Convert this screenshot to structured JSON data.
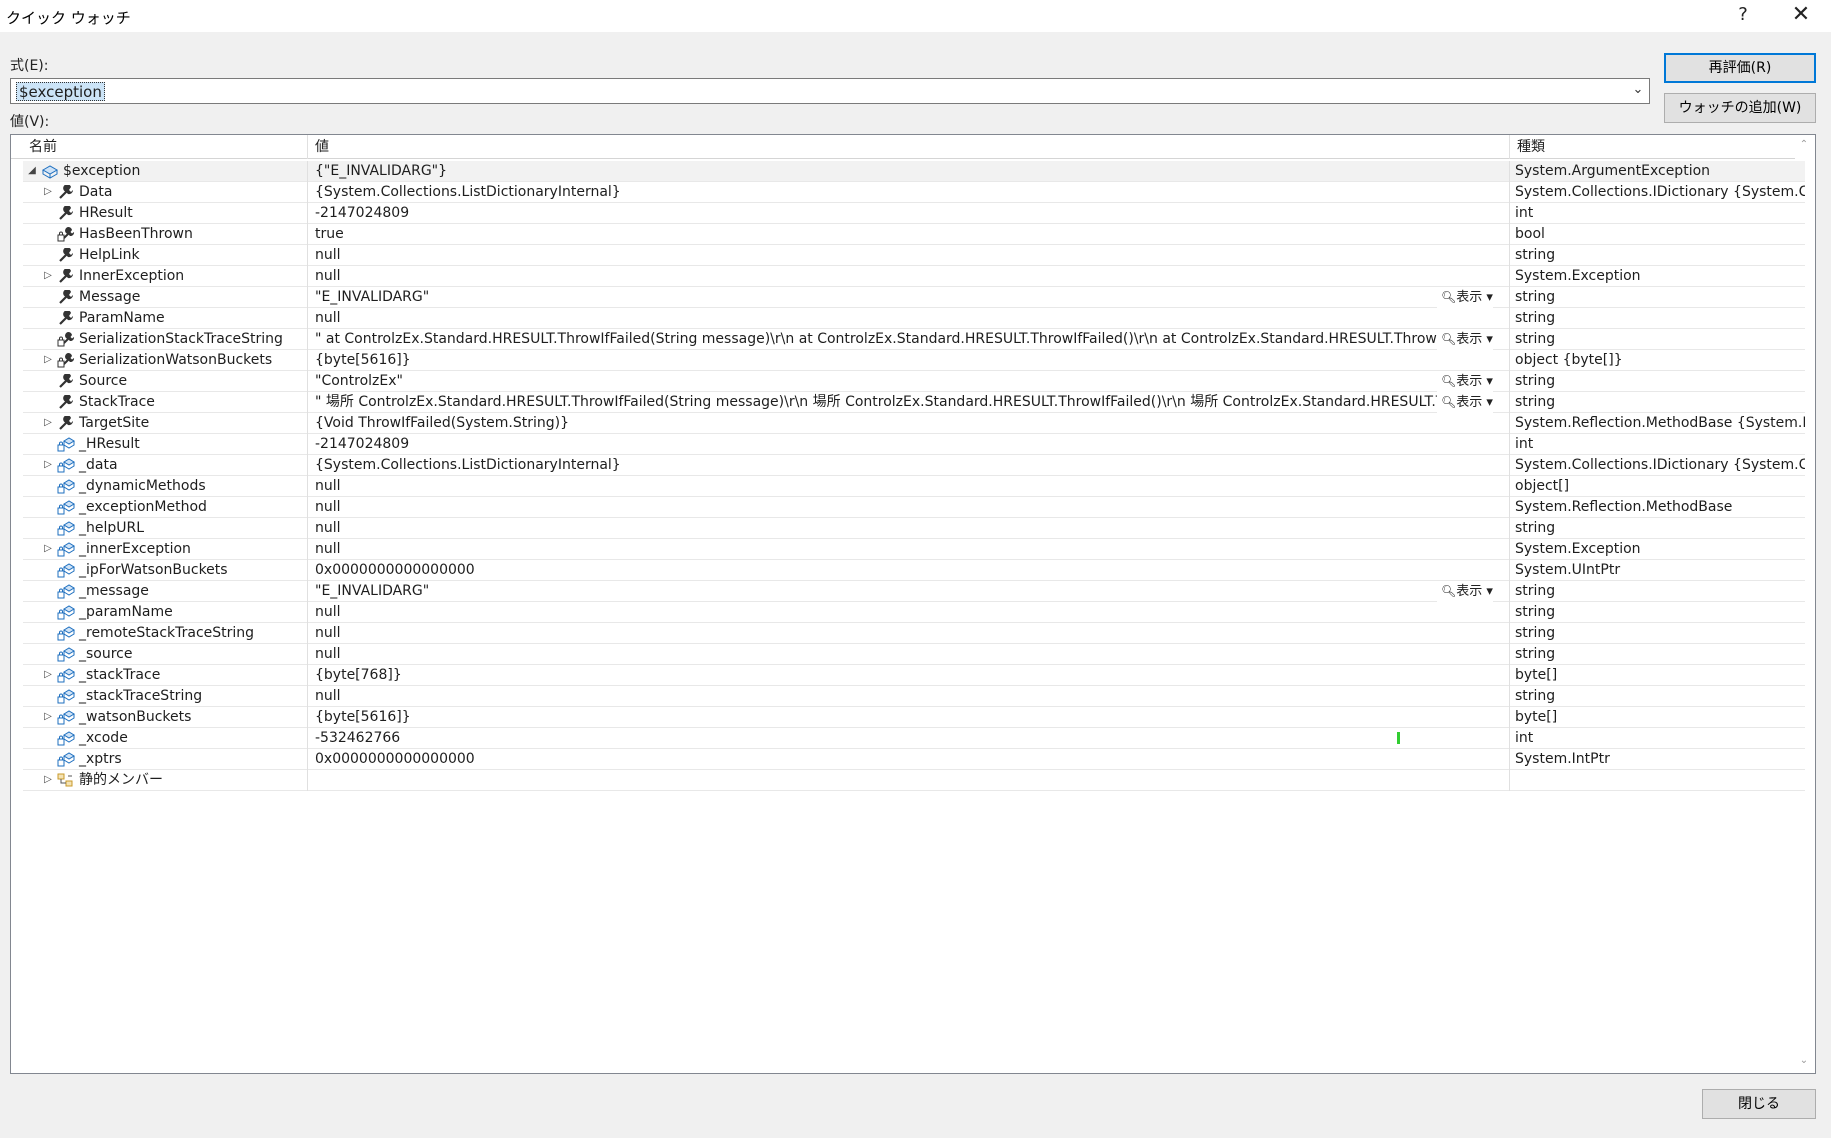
{
  "window": {
    "title": "クイック ウォッチ",
    "help_label": "?",
    "close_glyph": "✕"
  },
  "expression": {
    "label": "式(E):",
    "value": "$exception"
  },
  "value_label": "値(V):",
  "buttons": {
    "reevaluate": "再評価(R)",
    "add_watch": "ウォッチの追加(W)",
    "close": "閉じる"
  },
  "grid": {
    "headers": {
      "name": "名前",
      "value": "値",
      "type": "種類"
    },
    "visualizer_label": "表示",
    "rows": [
      {
        "name": "$exception",
        "value": "{\"E_INVALIDARG\"}",
        "type": "System.ArgumentException",
        "icon": "object-icon",
        "level": 0,
        "expander": "expanded"
      },
      {
        "name": "Data",
        "value": "{System.Collections.ListDictionaryInternal}",
        "type": "System.Collections.IDictionary {System.Col...",
        "icon": "wrench-icon",
        "level": 1,
        "expander": "collapsed"
      },
      {
        "name": "HResult",
        "value": "-2147024809",
        "type": "int",
        "icon": "wrench-icon",
        "level": 1,
        "expander": ""
      },
      {
        "name": "HasBeenThrown",
        "value": "true",
        "type": "bool",
        "icon": "locked-wrench-icon",
        "level": 1,
        "expander": ""
      },
      {
        "name": "HelpLink",
        "value": "null",
        "type": "string",
        "icon": "wrench-icon",
        "level": 1,
        "expander": ""
      },
      {
        "name": "InnerException",
        "value": "null",
        "type": "System.Exception",
        "icon": "wrench-icon",
        "level": 1,
        "expander": "collapsed"
      },
      {
        "name": "Message",
        "value": "\"E_INVALIDARG\"",
        "type": "string",
        "icon": "wrench-icon",
        "level": 1,
        "expander": "",
        "viz": true
      },
      {
        "name": "ParamName",
        "value": "null",
        "type": "string",
        "icon": "wrench-icon",
        "level": 1,
        "expander": ""
      },
      {
        "name": "SerializationStackTraceString",
        "value": "\"   at ControlzEx.Standard.HRESULT.ThrowIfFailed(String message)\\r\\n   at ControlzEx.Standard.HRESULT.ThrowIfFailed()\\r\\n   at ControlzEx.Standard.HRESULT.ThrowLast...",
        "type": "string",
        "icon": "locked-wrench-icon",
        "level": 1,
        "expander": "",
        "viz": true
      },
      {
        "name": "SerializationWatsonBuckets",
        "value": "{byte[5616]}",
        "type": "object {byte[]}",
        "icon": "locked-wrench-icon",
        "level": 1,
        "expander": "collapsed"
      },
      {
        "name": "Source",
        "value": "\"ControlzEx\"",
        "type": "string",
        "icon": "wrench-icon",
        "level": 1,
        "expander": "",
        "viz": true
      },
      {
        "name": "StackTrace",
        "value": "\"   場所 ControlzEx.Standard.HRESULT.ThrowIfFailed(String message)\\r\\n   場所 ControlzEx.Standard.HRESULT.ThrowIfFailed()\\r\\n   場所 ControlzEx.Standard.HRESULT.Th...",
        "type": "string",
        "icon": "wrench-icon",
        "level": 1,
        "expander": "",
        "viz": true
      },
      {
        "name": "TargetSite",
        "value": "{Void ThrowIfFailed(System.String)}",
        "type": "System.Reflection.MethodBase {System.Re...",
        "icon": "wrench-icon",
        "level": 1,
        "expander": "collapsed"
      },
      {
        "name": "_HResult",
        "value": "-2147024809",
        "type": "int",
        "icon": "private-field-icon",
        "level": 1,
        "expander": ""
      },
      {
        "name": "_data",
        "value": "{System.Collections.ListDictionaryInternal}",
        "type": "System.Collections.IDictionary {System.Col...",
        "icon": "private-field-icon",
        "level": 1,
        "expander": "collapsed"
      },
      {
        "name": "_dynamicMethods",
        "value": "null",
        "type": "object[]",
        "icon": "private-field-icon",
        "level": 1,
        "expander": ""
      },
      {
        "name": "_exceptionMethod",
        "value": "null",
        "type": "System.Reflection.MethodBase",
        "icon": "private-field-icon",
        "level": 1,
        "expander": ""
      },
      {
        "name": "_helpURL",
        "value": "null",
        "type": "string",
        "icon": "private-field-icon",
        "level": 1,
        "expander": ""
      },
      {
        "name": "_innerException",
        "value": "null",
        "type": "System.Exception",
        "icon": "private-field-icon",
        "level": 1,
        "expander": "collapsed"
      },
      {
        "name": "_ipForWatsonBuckets",
        "value": "0x0000000000000000",
        "type": "System.UIntPtr",
        "icon": "private-field-icon",
        "level": 1,
        "expander": ""
      },
      {
        "name": "_message",
        "value": "\"E_INVALIDARG\"",
        "type": "string",
        "icon": "private-field-icon",
        "level": 1,
        "expander": "",
        "viz": true
      },
      {
        "name": "_paramName",
        "value": "null",
        "type": "string",
        "icon": "private-field-icon",
        "level": 1,
        "expander": ""
      },
      {
        "name": "_remoteStackTraceString",
        "value": "null",
        "type": "string",
        "icon": "private-field-icon",
        "level": 1,
        "expander": ""
      },
      {
        "name": "_source",
        "value": "null",
        "type": "string",
        "icon": "private-field-icon",
        "level": 1,
        "expander": ""
      },
      {
        "name": "_stackTrace",
        "value": "{byte[768]}",
        "type": "byte[]",
        "icon": "private-field-icon",
        "level": 1,
        "expander": "collapsed"
      },
      {
        "name": "_stackTraceString",
        "value": "null",
        "type": "string",
        "icon": "private-field-icon",
        "level": 1,
        "expander": ""
      },
      {
        "name": "_watsonBuckets",
        "value": "{byte[5616]}",
        "type": "byte[]",
        "icon": "private-field-icon",
        "level": 1,
        "expander": "collapsed"
      },
      {
        "name": "_xcode",
        "value": "-532462766",
        "type": "int",
        "icon": "private-field-icon",
        "level": 1,
        "expander": "",
        "mark": true
      },
      {
        "name": "_xptrs",
        "value": "0x0000000000000000",
        "type": "System.IntPtr",
        "icon": "private-field-icon",
        "level": 1,
        "expander": ""
      },
      {
        "name": "静的メンバー",
        "value": "",
        "type": "",
        "icon": "static-members-icon",
        "level": 1,
        "expander": "collapsed"
      }
    ]
  },
  "colors": {
    "selection": "#cce4f7",
    "accent": "#0078d7",
    "field_icon": "#1e6fbf",
    "static_icon": "#c89a2a",
    "change_mark": "#32cd32"
  }
}
